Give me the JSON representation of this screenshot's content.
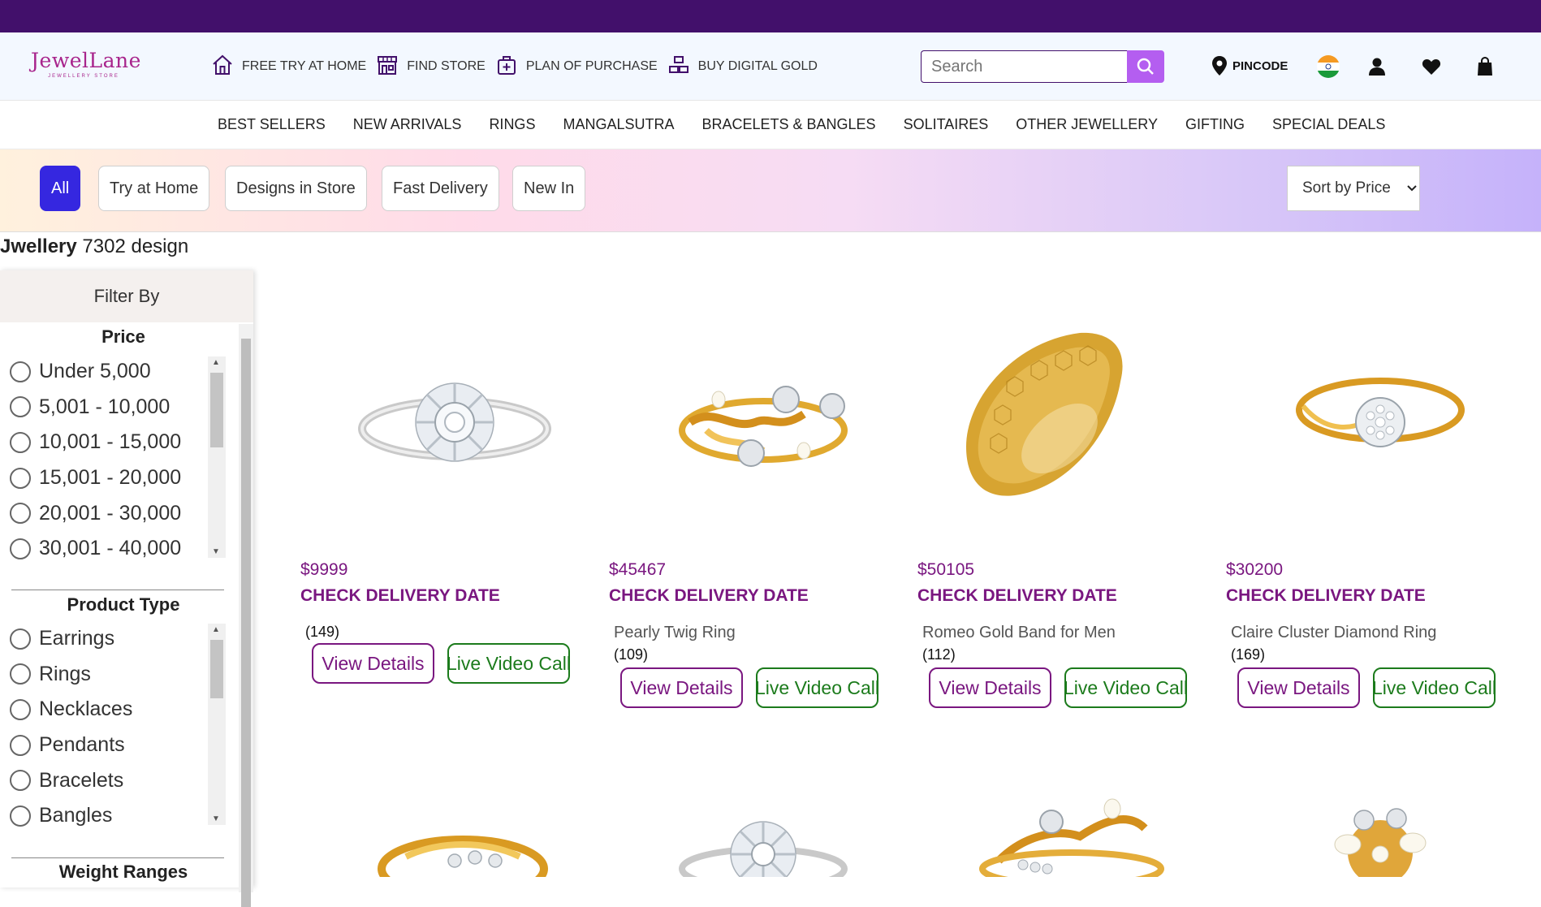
{
  "header": {
    "logo_name": "JewelLane",
    "logo_tag": "JEWELLERY STORE",
    "quick_links": [
      {
        "label": "FREE TRY AT HOME",
        "icon": "home-icon"
      },
      {
        "label": "FIND STORE",
        "icon": "store-icon"
      },
      {
        "label": "PLAN OF PURCHASE",
        "icon": "plan-box-icon"
      },
      {
        "label": "BUY DIGITAL GOLD",
        "icon": "gold-bars-icon"
      }
    ],
    "search_placeholder": "Search",
    "pincode_label": "PINCODE",
    "brand_color": "#42106b",
    "accent_color": "#b45ef0"
  },
  "nav": {
    "items": [
      "BEST SELLERS",
      "NEW ARRIVALS",
      "RINGS",
      "MANGALSUTRA",
      "BRACELETS & BANGLES",
      "SOLITAIRES",
      "OTHER JEWELLERY",
      "GIFTING",
      "SPECIAL DEALS"
    ]
  },
  "filters": {
    "chips": [
      "All",
      "Try at Home",
      "Designs in Store",
      "Fast Delivery",
      "New In"
    ],
    "active_chip": "All",
    "sort_label": "Sort by Price"
  },
  "listing": {
    "category": "Jwellery",
    "count_text": "7302 design"
  },
  "sidebar": {
    "heading": "Filter By",
    "price": {
      "title": "Price",
      "options": [
        "Under 5,000",
        "5,001 - 10,000",
        "10,001 - 15,000",
        "15,001 - 20,000",
        "20,001 - 30,000",
        "30,001 - 40,000"
      ]
    },
    "product_type": {
      "title": "Product Type",
      "options": [
        "Earrings",
        "Rings",
        "Necklaces",
        "Pendants",
        "Bracelets",
        "Bangles"
      ]
    },
    "weight": {
      "title": "Weight Ranges"
    }
  },
  "products": [
    {
      "price": "$9999",
      "delivery": "CHECK DELIVERY DATE",
      "name": "",
      "reviews": "(149)",
      "view_label": "View Details",
      "call_label": "Live Video Call",
      "image": "silver-sunburst-diamond-ring"
    },
    {
      "price": "$45467",
      "delivery": "CHECK DELIVERY DATE",
      "name": "Pearly Twig Ring",
      "reviews": "(109)",
      "view_label": "View Details",
      "call_label": "Live Video Call",
      "image": "gold-twig-pearl-ring"
    },
    {
      "price": "$50105",
      "delivery": "CHECK DELIVERY DATE",
      "name": "Romeo Gold Band for Men",
      "reviews": "(112)",
      "view_label": "View Details",
      "call_label": "Live Video Call",
      "image": "gold-hexagon-band"
    },
    {
      "price": "$30200",
      "delivery": "CHECK DELIVERY DATE",
      "name": "Claire Cluster Diamond Ring",
      "reviews": "(169)",
      "view_label": "View Details",
      "call_label": "Live Video Call",
      "image": "gold-cluster-diamond-ring"
    }
  ]
}
